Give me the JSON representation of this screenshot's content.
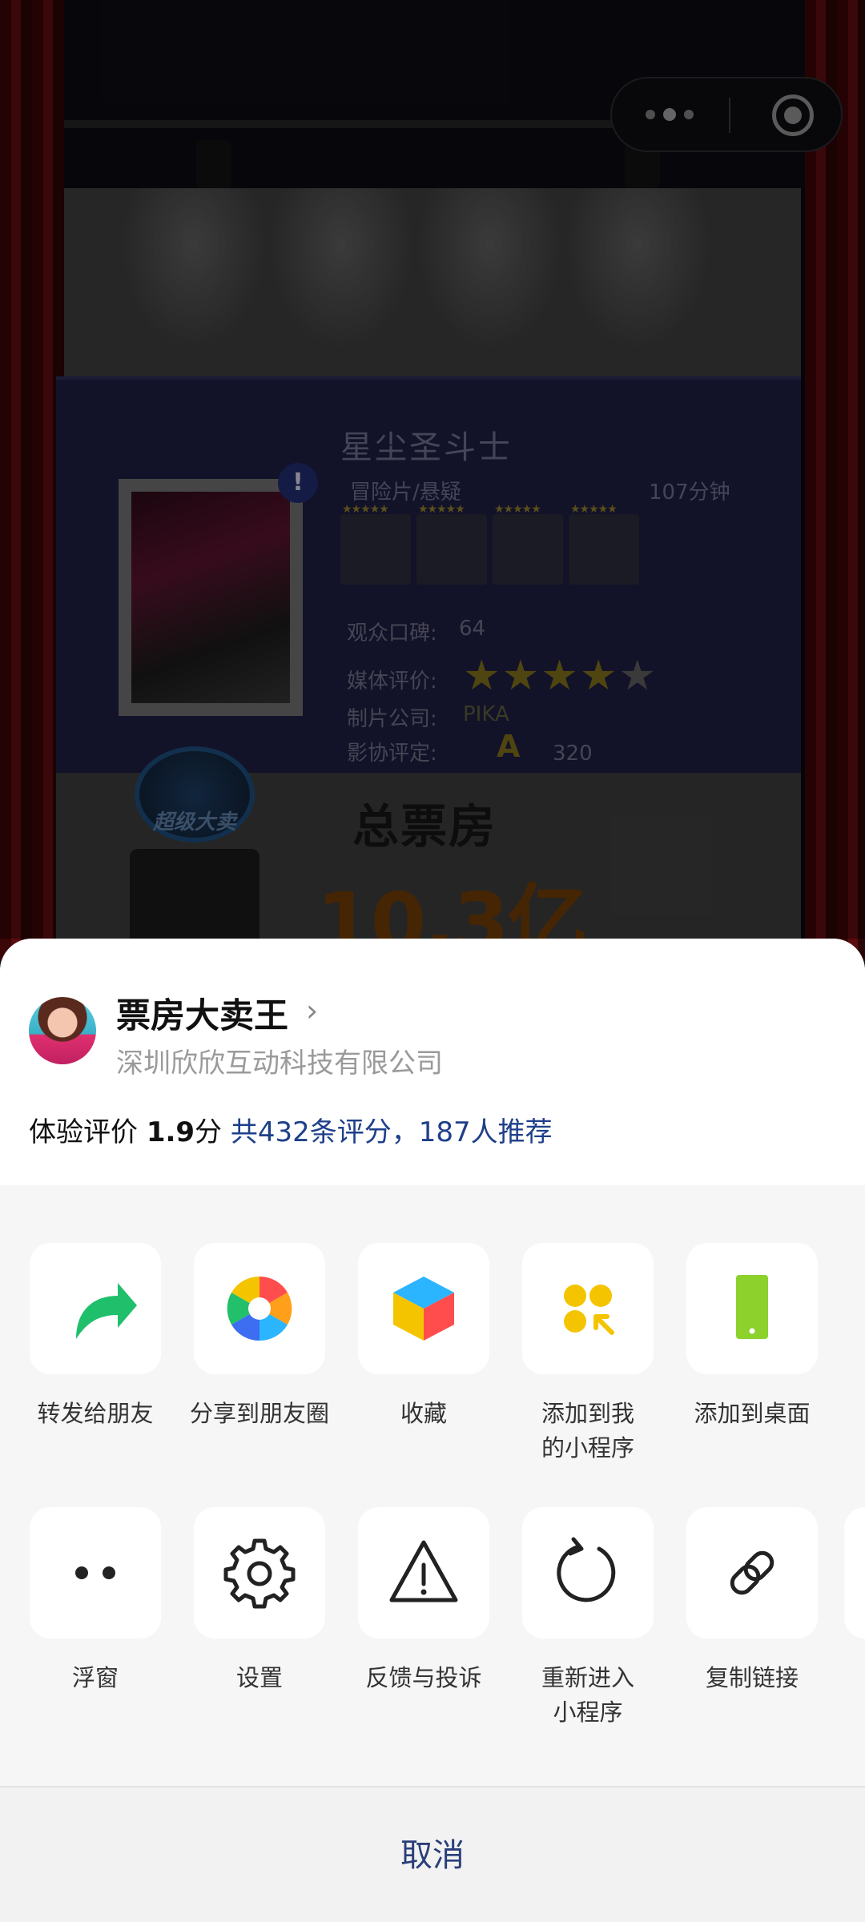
{
  "background": {
    "movie": {
      "title": "星尘圣斗士",
      "genre": "冒险片/悬疑",
      "runtime": "107分钟",
      "audience_label": "观众口碑:",
      "audience_value": "64",
      "media_label": "媒体评价:",
      "media_stars": 4,
      "studio_label": "制片公司:",
      "studio_value": "PIKA",
      "rating_label": "影协评定:",
      "rating_grade": "A",
      "rating_value": "320"
    },
    "badge_text": "超级大卖",
    "box_office_label": "总票房",
    "box_office_value": "10.3亿"
  },
  "capsule": {
    "more_icon": "more-dots-icon",
    "close_icon": "target-close-icon"
  },
  "sheet": {
    "app_name": "票房大卖王",
    "company": "深圳欣欣互动科技有限公司",
    "rating": {
      "prefix": "体验评价 ",
      "score": "1.9",
      "unit": "分 ",
      "reviews": "共432条评分，187人推荐"
    },
    "row1": [
      {
        "label": "转发给朋友",
        "icon": "share-arrow-icon",
        "color": "#1fbf6b"
      },
      {
        "label": "分享到朋友圈",
        "icon": "moments-aperture-icon"
      },
      {
        "label": "收藏",
        "icon": "favorite-cube-icon"
      },
      {
        "label": "添加到我的小程序",
        "icon": "add-mini-program-icon",
        "color": "#f5c400"
      },
      {
        "label": "添加到桌面",
        "icon": "add-to-desktop-icon",
        "color": "#8cd12c"
      }
    ],
    "row2": [
      {
        "label": "浮窗",
        "icon": "floating-window-icon"
      },
      {
        "label": "设置",
        "icon": "settings-gear-icon"
      },
      {
        "label": "反馈与投诉",
        "icon": "warning-triangle-icon"
      },
      {
        "label": "重新进入小程序",
        "icon": "reload-icon"
      },
      {
        "label": "复制链接",
        "icon": "copy-link-icon"
      }
    ],
    "cancel": "取消"
  }
}
